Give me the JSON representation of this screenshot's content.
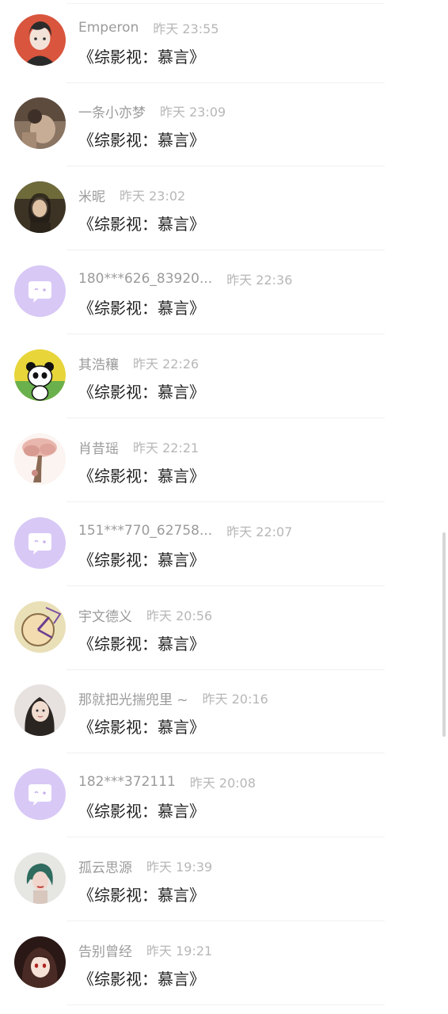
{
  "items": [
    {
      "username": "Emperon",
      "time": "昨天 23:55",
      "message": "《综影视：慕言》",
      "avatar": "anime-boy-avatar"
    },
    {
      "username": "一条小亦梦",
      "time": "昨天 23:09",
      "message": "《综影视：慕言》",
      "avatar": "photo-avatar"
    },
    {
      "username": "米昵",
      "time": "昨天 23:02",
      "message": "《综影视：慕言》",
      "avatar": "girl-photo-avatar"
    },
    {
      "username": "180***626_83920...",
      "time": "昨天 22:36",
      "message": "《综影视：慕言》",
      "avatar": "default-chat-avatar"
    },
    {
      "username": "其浩穰",
      "time": "昨天 22:26",
      "message": "《综影视：慕言》",
      "avatar": "panda-avatar"
    },
    {
      "username": "肖昔瑶",
      "time": "昨天 22:21",
      "message": "《综影视：慕言》",
      "avatar": "pink-tree-avatar"
    },
    {
      "username": "151***770_62758...",
      "time": "昨天 22:07",
      "message": "《综影视：慕言》",
      "avatar": "default-chat-avatar"
    },
    {
      "username": "宇文德义",
      "time": "昨天 20:56",
      "message": "《综影视：慕言》",
      "avatar": "clock-avatar"
    },
    {
      "username": "那就把光揣兜里 ~",
      "time": "昨天 20:16",
      "message": "《综影视：慕言》",
      "avatar": "girl-photo-avatar"
    },
    {
      "username": "182***372111",
      "time": "昨天 20:08",
      "message": "《综影视：慕言》",
      "avatar": "default-chat-avatar"
    },
    {
      "username": "孤云思源",
      "time": "昨天 19:39",
      "message": "《综影视：慕言》",
      "avatar": "green-hair-avatar"
    },
    {
      "username": "告别曾经",
      "time": "昨天 19:21",
      "message": "《综影视：慕言》",
      "avatar": "anime-girl-avatar"
    }
  ],
  "colors": {
    "default_avatar_bg": "#d8c8f6",
    "username": "#9b9b9b",
    "timestamp": "#b7b7b7",
    "message": "#222222"
  }
}
